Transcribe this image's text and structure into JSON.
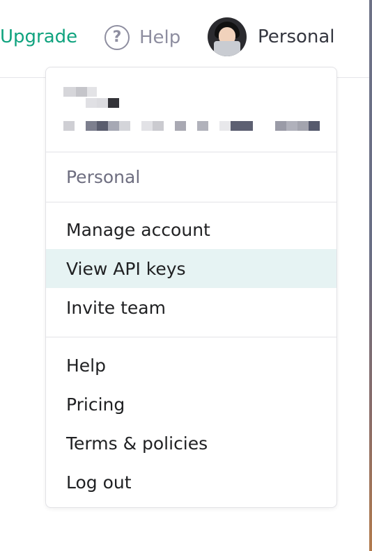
{
  "topbar": {
    "upgrade_label": "Upgrade",
    "help_label": "Help",
    "help_icon_glyph": "?",
    "account_label": "Personal",
    "brand_color": "#10a37f"
  },
  "menu": {
    "section_label": "Personal",
    "account_items": [
      {
        "label": "Manage account"
      },
      {
        "label": "View API keys"
      },
      {
        "label": "Invite team"
      }
    ],
    "general_items": [
      {
        "label": "Help"
      },
      {
        "label": "Pricing"
      },
      {
        "label": "Terms & policies"
      },
      {
        "label": "Log out"
      }
    ],
    "highlighted_item": "View API keys",
    "highlight_color": "#e6f3f3"
  }
}
